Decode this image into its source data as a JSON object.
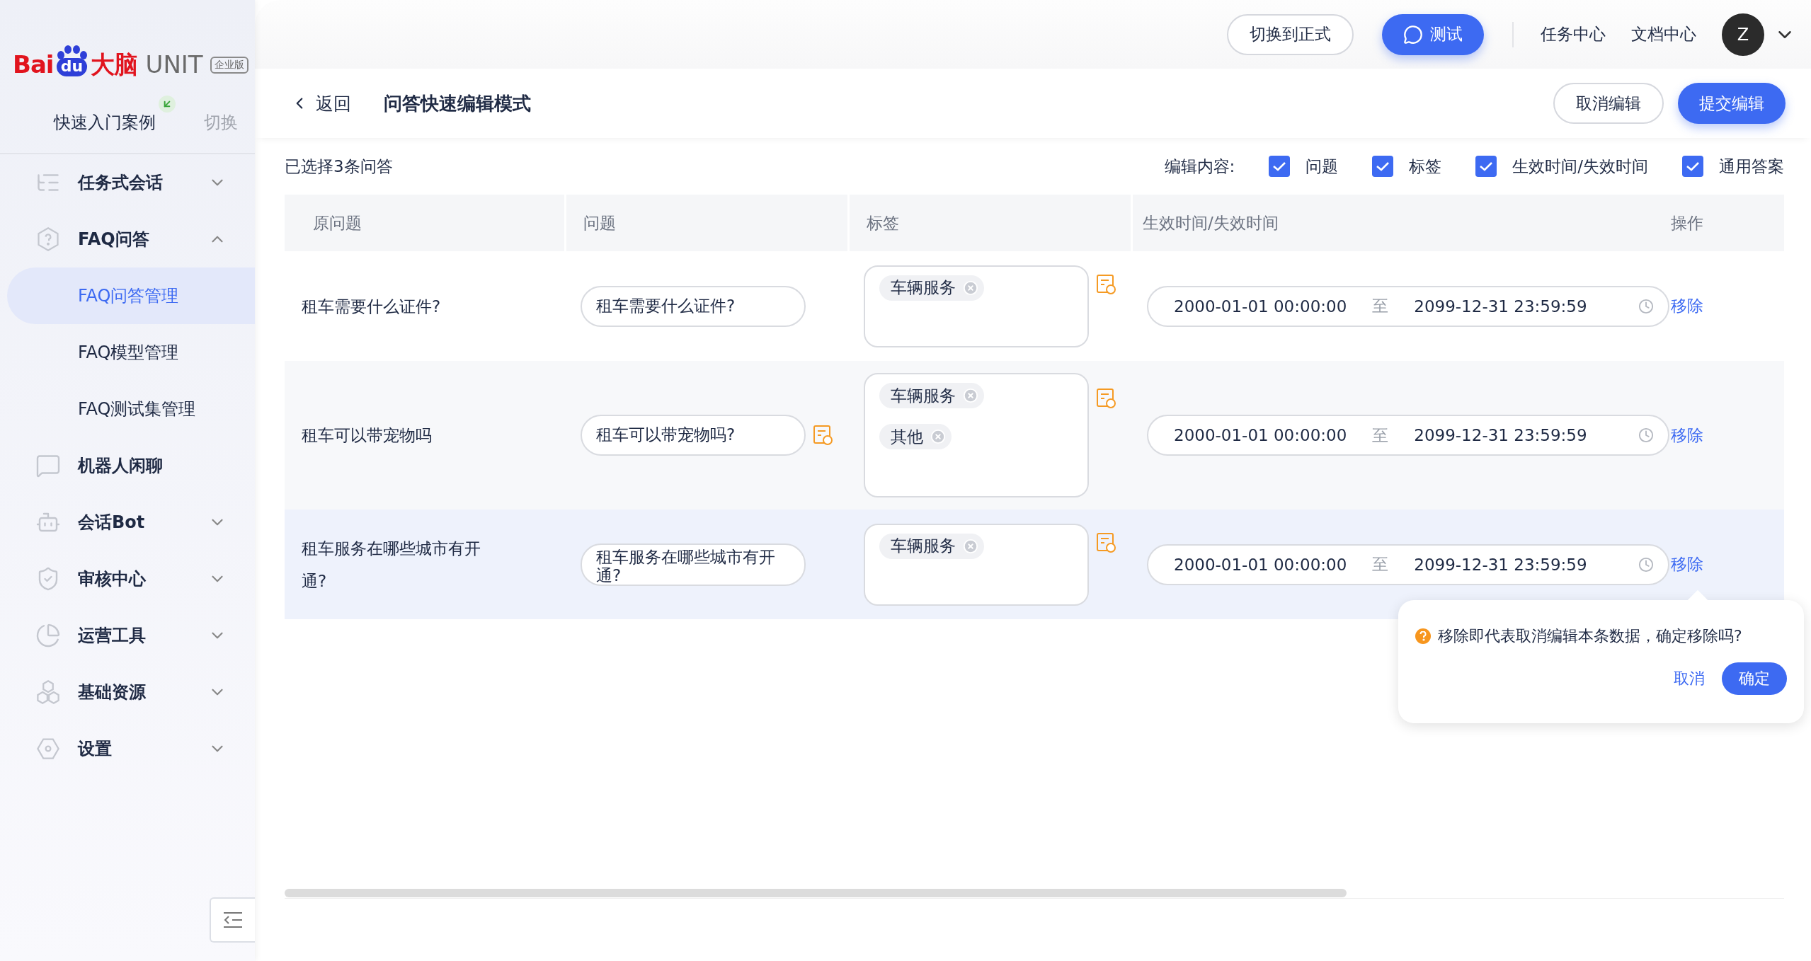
{
  "logo": {
    "wordmark": "Bai",
    "paw_text": "du",
    "brain": "大脑",
    "product": "UNIT",
    "edition": "企业版"
  },
  "project": {
    "name": "快速入门案例",
    "switch": "切换"
  },
  "sidebar": {
    "items": [
      {
        "label": "任务式会话",
        "kind": "group",
        "expanded": false
      },
      {
        "label": "FAQ问答",
        "kind": "group",
        "expanded": true,
        "children": [
          {
            "label": "FAQ问答管理",
            "selected": true
          },
          {
            "label": "FAQ模型管理",
            "selected": false
          },
          {
            "label": "FAQ测试集管理",
            "selected": false
          }
        ]
      },
      {
        "label": "机器人闲聊",
        "kind": "leaf"
      },
      {
        "label": "会话Bot",
        "kind": "group",
        "expanded": false
      },
      {
        "label": "审核中心",
        "kind": "group",
        "expanded": false
      },
      {
        "label": "运营工具",
        "kind": "group",
        "expanded": false
      },
      {
        "label": "基础资源",
        "kind": "group",
        "expanded": false
      },
      {
        "label": "设置",
        "kind": "group",
        "expanded": false
      }
    ]
  },
  "top_bar": {
    "switch_button": "切换到正式",
    "test_button": "测试",
    "links": [
      "任务中心",
      "文档中心"
    ],
    "avatar": "Z"
  },
  "header": {
    "back": "返回",
    "title": "问答快速编辑模式",
    "buttons": [
      {
        "label": "取消编辑",
        "kind": "secondary"
      },
      {
        "label": "提交编辑",
        "kind": "primary"
      }
    ]
  },
  "toolbar": {
    "selection": "已选择3条问答",
    "edit_label": "编辑内容:",
    "options": [
      {
        "label": "问题",
        "checked": true
      },
      {
        "label": "标签",
        "checked": true
      },
      {
        "label": "生效时间/失效时间",
        "checked": true
      },
      {
        "label": "通用答案",
        "checked": true
      }
    ]
  },
  "table": {
    "columns": [
      "原问题",
      "问题",
      "标签",
      "生效时间/失效时间",
      "操作"
    ],
    "rows": [
      {
        "original": "租车需要什么证件?",
        "question": "租车需要什么证件?",
        "question_note": false,
        "tags": [
          "车辆服务"
        ],
        "start": "2000-01-01 00:00:00",
        "separator": "至",
        "end": "2099-12-31 23:59:59",
        "action": "移除",
        "highlighted": false
      },
      {
        "original": "租车可以带宠物吗",
        "question": "租车可以带宠物吗?",
        "question_note": true,
        "tags": [
          "车辆服务",
          "其他"
        ],
        "start": "2000-01-01 00:00:00",
        "separator": "至",
        "end": "2099-12-31 23:59:59",
        "action": "移除",
        "highlighted": false
      },
      {
        "original": "租车服务在哪些城市有开通?",
        "question": "租车服务在哪些城市有开通?",
        "question_note": false,
        "tags": [
          "车辆服务"
        ],
        "start": "2000-01-01 00:00:00",
        "separator": "至",
        "end": "2099-12-31 23:59:59",
        "action": "移除",
        "highlighted": true
      }
    ]
  },
  "popover": {
    "message": "移除即代表取消编辑本条数据，确定移除吗?",
    "cancel": "取消",
    "confirm": "确定"
  }
}
